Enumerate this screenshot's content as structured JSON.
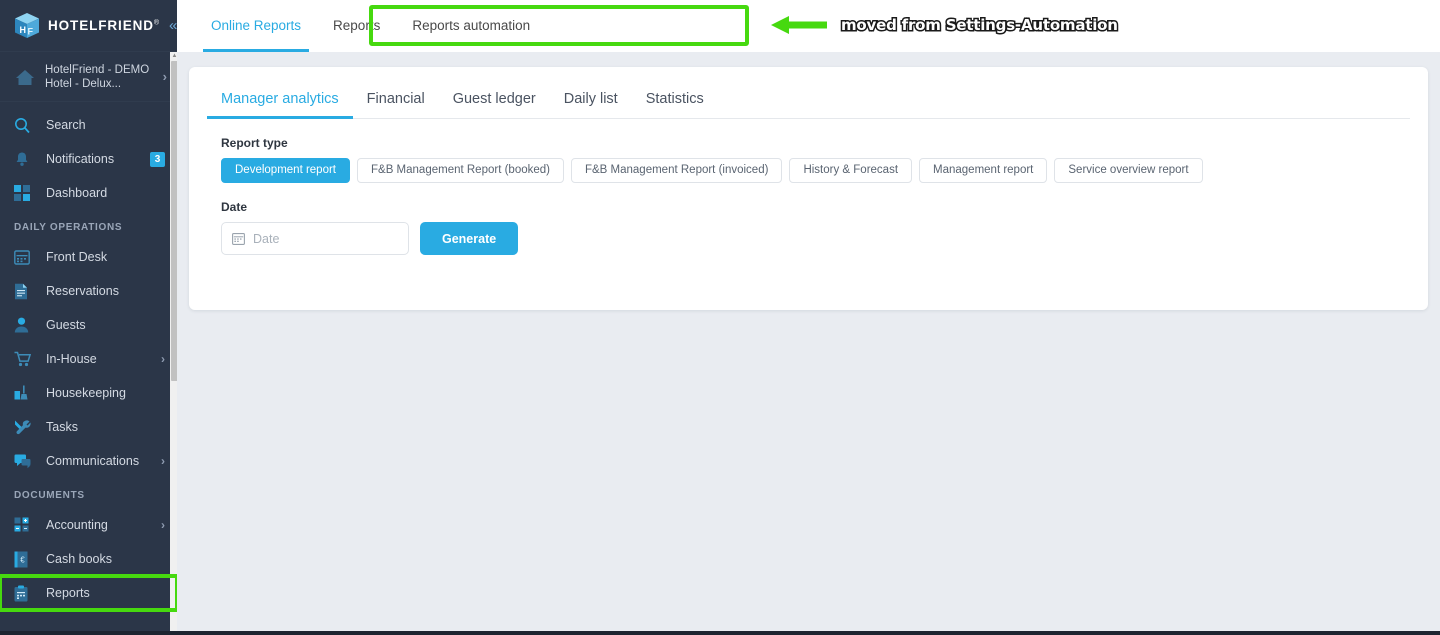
{
  "brand": {
    "name": "HOTELFRIEND",
    "registered": "®",
    "logo_icon": "cube-hf-icon",
    "collapse_icon": "double-chevron-left-icon"
  },
  "sidebar": {
    "hotel_selector": {
      "icon": "home-icon",
      "label": "HotelFriend - DEMO Hotel - Delux...",
      "chevron": "›"
    },
    "items": [
      {
        "label": "Search",
        "icon": "search-icon"
      },
      {
        "label": "Notifications",
        "icon": "bell-icon",
        "badge": "3"
      },
      {
        "label": "Dashboard",
        "icon": "grid-icon"
      },
      {
        "section": "DAILY OPERATIONS"
      },
      {
        "label": "Front Desk",
        "icon": "calendar-icon"
      },
      {
        "label": "Reservations",
        "icon": "document-icon"
      },
      {
        "label": "Guests",
        "icon": "user-icon"
      },
      {
        "label": "In-House",
        "icon": "cart-icon",
        "chevron": "›"
      },
      {
        "label": "Housekeeping",
        "icon": "broom-icon"
      },
      {
        "label": "Tasks",
        "icon": "tools-icon"
      },
      {
        "label": "Communications",
        "icon": "chat-icon",
        "chevron": "›"
      },
      {
        "section": "DOCUMENTS"
      },
      {
        "label": "Accounting",
        "icon": "calculator-icon",
        "chevron": "›"
      },
      {
        "label": "Cash books",
        "icon": "book-icon"
      },
      {
        "label": "Reports",
        "icon": "clipboard-icon",
        "highlighted": true
      }
    ]
  },
  "topbar": {
    "tabs": [
      {
        "label": "Online Reports",
        "active": true
      },
      {
        "label": "Reports",
        "active": false
      },
      {
        "label": "Reports automation",
        "active": false
      }
    ],
    "annotation": {
      "arrow_icon": "left-arrow-annotation-icon",
      "text": "moved from Settings-Automation"
    }
  },
  "main": {
    "tabs": [
      {
        "label": "Manager analytics",
        "active": true
      },
      {
        "label": "Financial",
        "active": false
      },
      {
        "label": "Guest ledger",
        "active": false
      },
      {
        "label": "Daily list",
        "active": false
      },
      {
        "label": "Statistics",
        "active": false
      }
    ],
    "report_type": {
      "label": "Report type",
      "options": [
        {
          "label": "Development report",
          "active": true
        },
        {
          "label": "F&B Management Report (booked)",
          "active": false
        },
        {
          "label": "F&B Management Report (invoiced)",
          "active": false
        },
        {
          "label": "History & Forecast",
          "active": false
        },
        {
          "label": "Management report",
          "active": false
        },
        {
          "label": "Service overview report",
          "active": false
        }
      ]
    },
    "date": {
      "label": "Date",
      "value": "",
      "placeholder": "Date",
      "icon": "calendar-icon"
    },
    "generate_label": "Generate"
  },
  "colors": {
    "accent": "#29abe2",
    "sidebar_bg": "#2b3648",
    "page_bg": "#e9ecf1",
    "highlight_green": "#46d90f",
    "card_bg": "#ffffff"
  }
}
